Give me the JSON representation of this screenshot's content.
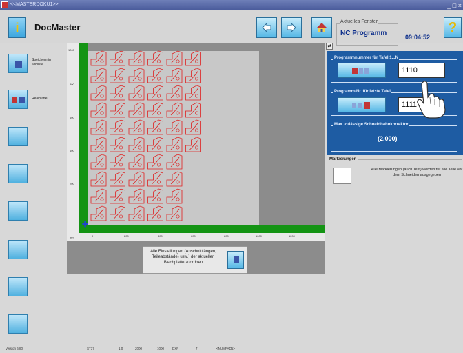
{
  "window": {
    "title": "<<MASTERDOKU1>>",
    "controls": "_ □ ×"
  },
  "header": {
    "app_title": "DocMaster",
    "current_window_label": "Aktuelles Fenster",
    "current_window_value": "NC Programm",
    "clock": "09:04:52"
  },
  "icons": {
    "logo": "info-i-icon",
    "back": "arrow-left-icon",
    "forward": "arrow-right-icon",
    "home": "house-icon",
    "help": "question-icon"
  },
  "sidebar": {
    "items": [
      {
        "label": "Speichern in Jobliste"
      },
      {
        "label": "Realplatte"
      },
      {
        "label": ""
      },
      {
        "label": ""
      },
      {
        "label": ""
      },
      {
        "label": ""
      },
      {
        "label": ""
      },
      {
        "label": ""
      }
    ]
  },
  "plate": {
    "y_ticks": [
      "1000",
      "800",
      "600",
      "400",
      "200"
    ],
    "x_unit": "mm",
    "x_ticks": [
      "0",
      "200",
      "400",
      "600",
      "800",
      "1000",
      "1200"
    ],
    "rows": 10,
    "columns": [
      5,
      5,
      5,
      5,
      6,
      6,
      6,
      6,
      6,
      6
    ]
  },
  "apply": {
    "text": "Alle Einstellungen (Anschnittlängen, Teileabstände) usw.) der aktuellen Blechplatte zuordnen"
  },
  "program": {
    "group1_label": "Programmnummer für Tafel 1...N",
    "field1_value": "1110",
    "group2_label": "Programm-Nr. für letzte Tafel",
    "field2_value": "1111",
    "group3_label": "Max. zulässige Schneidbahnkorrektor",
    "correction_value": "(2.000)"
  },
  "marks": {
    "label": "Markierungen",
    "description": "Alle Markierungen (auch Text) werden für alle Teile vor dem Schneiden ausgegeben"
  },
  "status": {
    "version": "Version 6.80",
    "material": "ST37",
    "thickness": "1.0",
    "width": "2000",
    "height": "1000",
    "format": "DXF",
    "count": "7",
    "mode": "<NUMPAD5>"
  },
  "colors": {
    "panel_blue": "#1e5ca3",
    "axis_green": "#149414",
    "part_red": "#e02020"
  }
}
